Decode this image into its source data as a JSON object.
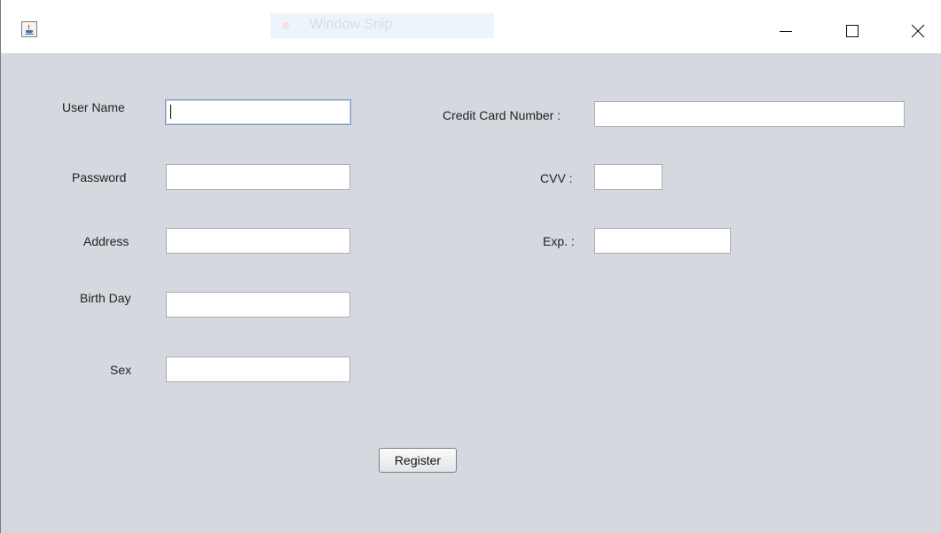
{
  "window": {
    "snip_label": "Window Snip",
    "icons": {
      "app": "java-app-icon",
      "minimize": "minimize-icon",
      "maximize": "maximize-icon",
      "close": "close-icon"
    }
  },
  "form": {
    "left": {
      "username_label": "User Name",
      "password_label": "Password",
      "address_label": "Address",
      "birthday_label": "Birth Day",
      "sex_label": "Sex"
    },
    "right": {
      "card_label": "Credit Card Number :",
      "cvv_label": "CVV :",
      "exp_label": "Exp. :"
    },
    "values": {
      "username": "",
      "password": "",
      "address": "",
      "birthday": "",
      "sex": "",
      "card": "",
      "cvv": "",
      "exp": ""
    },
    "register_label": "Register"
  },
  "colors": {
    "panel_background": "#d5d8de",
    "focus_border": "#7a9cc6"
  }
}
